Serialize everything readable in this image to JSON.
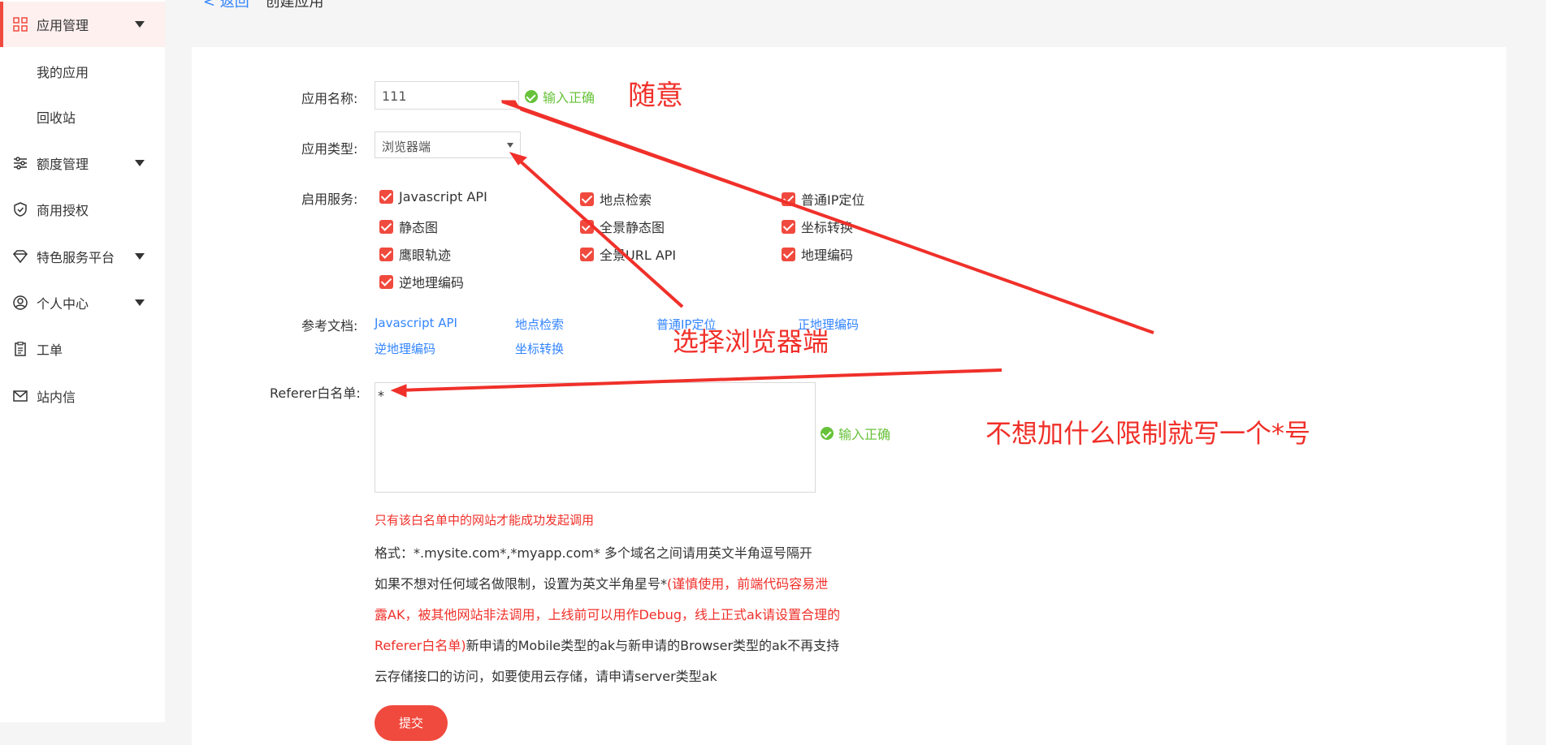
{
  "sidebar": {
    "items": [
      {
        "label": "应用管理",
        "icon": "grid-icon",
        "active": true,
        "caret": true
      },
      {
        "label": "我的应用",
        "sub": true
      },
      {
        "label": "回收站",
        "sub": true
      },
      {
        "label": "额度管理",
        "icon": "sliders-icon",
        "caret": true
      },
      {
        "label": "商用授权",
        "icon": "shield-check-icon"
      },
      {
        "label": "特色服务平台",
        "icon": "diamond-icon",
        "caret": true
      },
      {
        "label": "个人中心",
        "icon": "user-circle-icon",
        "caret": true
      },
      {
        "label": "工单",
        "icon": "clipboard-icon"
      },
      {
        "label": "站内信",
        "icon": "mail-icon"
      }
    ]
  },
  "breadcrumb": {
    "back": "< 返回",
    "title": "创建应用"
  },
  "form": {
    "app_name_label": "应用名称:",
    "app_name_value": "111",
    "app_name_status": "输入正确",
    "app_type_label": "应用类型:",
    "app_type_value": "浏览器端",
    "services_label": "启用服务:",
    "services": [
      "Javascript API",
      "地点检索",
      "普通IP定位",
      "静态图",
      "全景静态图",
      "坐标转换",
      "鹰眼轨迹",
      "全景URL API",
      "地理编码",
      "逆地理编码"
    ],
    "docs_label": "参考文档:",
    "docs": [
      "Javascript API",
      "地点检索",
      "普通IP定位",
      "正地理编码",
      "逆地理编码",
      "坐标转换"
    ],
    "referer_label": "Referer白名单:",
    "referer_value": "*",
    "referer_status": "输入正确",
    "notes": {
      "line1": "只有该白名单中的网站才能成功发起调用",
      "line2": "格式：*.mysite.com*,*myapp.com* 多个域名之间请用英文半角逗号隔开",
      "line3_a": "如果不想对任何域名做限制，设置为英文半角星号*",
      "line3_b": "(谨慎使用，前端代码容易泄",
      "line4": "露AK，被其他网站非法调用，上线前可以用作Debug，线上正式ak请设置合理的",
      "line5_a": "Referer白名单)",
      "line5_b": "新申请的Mobile类型的ak与新申请的Browser类型的ak不再支持",
      "line6": "云存储接口的访问，如要使用云存储，请申请server类型ak"
    },
    "submit_label": "提交"
  },
  "annotations": {
    "a1": "随意",
    "a2": "选择浏览器端",
    "a3": "不想加什么限制就写一个*号"
  },
  "colors": {
    "accent": "#f04a3e",
    "success": "#67c23a",
    "link": "#3385ff",
    "annotation": "#f0302a"
  }
}
